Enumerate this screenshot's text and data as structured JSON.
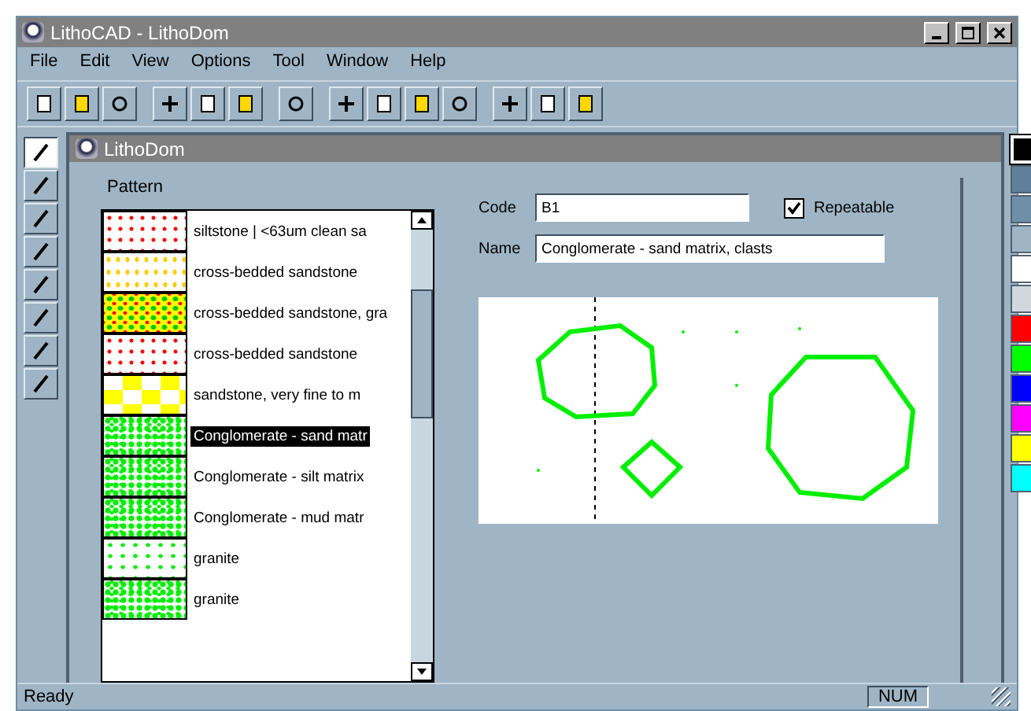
{
  "window": {
    "title": "LithoCAD - LithoDom"
  },
  "menu": [
    "File",
    "Edit",
    "View",
    "Options",
    "Tool",
    "Window",
    "Help"
  ],
  "tools": [
    {
      "selected": true
    },
    {
      "selected": false
    },
    {
      "selected": false
    },
    {
      "selected": false
    },
    {
      "selected": false
    },
    {
      "selected": false
    },
    {
      "selected": false
    },
    {
      "selected": false
    }
  ],
  "child": {
    "title": "LithoDom"
  },
  "pattern": {
    "label": "Pattern",
    "items": [
      {
        "kind": "red-dots",
        "text": "siltstone | <63um clean sa",
        "selected": false
      },
      {
        "kind": "yellow-dots",
        "text": "cross-bedded sandstone",
        "selected": false
      },
      {
        "kind": "yellow-green",
        "text": "cross-bedded sandstone, gra",
        "selected": false
      },
      {
        "kind": "red-dots",
        "text": "cross-bedded sandstone",
        "selected": false
      },
      {
        "kind": "yellow-check",
        "text": "sandstone, very fine to m",
        "selected": false
      },
      {
        "kind": "green-dense",
        "text": "Conglomerate - sand matr",
        "selected": true
      },
      {
        "kind": "green-dense",
        "text": "Conglomerate - silt matrix",
        "selected": false
      },
      {
        "kind": "green-dense",
        "text": "Conglomerate - mud matr",
        "selected": false
      },
      {
        "kind": "green-sparse",
        "text": "granite",
        "selected": false
      },
      {
        "kind": "green-dense",
        "text": "granite",
        "selected": false
      }
    ]
  },
  "code": {
    "label": "Code",
    "value": "B1"
  },
  "repeatable": {
    "label": "Repeatable",
    "checked": true
  },
  "name": {
    "label": "Name",
    "value": "Conglomerate - sand matrix, clasts"
  },
  "colors": [
    {
      "color": "#000000",
      "selected": true
    },
    {
      "color": "#5f7f9a",
      "selected": false
    },
    {
      "color": "#6f8ea8",
      "selected": false
    },
    {
      "color": "#9fb5c5",
      "selected": false
    },
    {
      "color": "#ffffff",
      "selected": false
    },
    {
      "color": "#d0d8de",
      "selected": false
    },
    {
      "color": "#ff0000",
      "selected": false
    },
    {
      "color": "#00ff00",
      "selected": false
    },
    {
      "color": "#0000ff",
      "selected": false
    },
    {
      "color": "#ff00ff",
      "selected": false
    },
    {
      "color": "#ffff00",
      "selected": false
    },
    {
      "color": "#00ffff",
      "selected": false
    }
  ],
  "status": {
    "text": "Ready",
    "indicator": "NUM"
  }
}
